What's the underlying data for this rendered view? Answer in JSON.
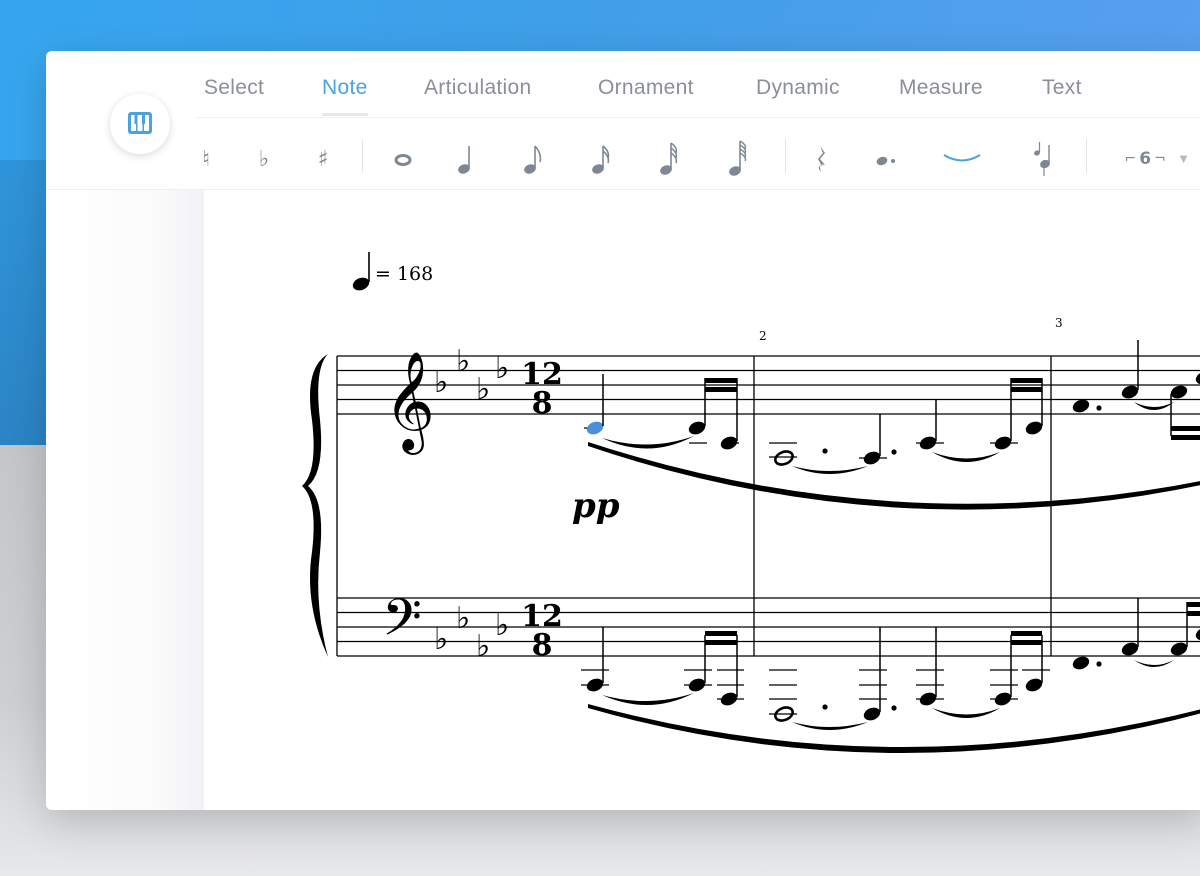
{
  "tabs": [
    {
      "label": "Select",
      "active": false
    },
    {
      "label": "Note",
      "active": true
    },
    {
      "label": "Articulation",
      "active": false
    },
    {
      "label": "Ornament",
      "active": false
    },
    {
      "label": "Dynamic",
      "active": false
    },
    {
      "label": "Measure",
      "active": false
    },
    {
      "label": "Text",
      "active": false
    }
  ],
  "tools": {
    "natural": "♮",
    "flat": "♭",
    "sharp": "♯",
    "tuplet": "6"
  },
  "score": {
    "tempo_value": "= 168",
    "time_signature_top": "12",
    "time_signature_bottom": "8",
    "dynamic": "pp",
    "bar_numbers": [
      "2",
      "3"
    ]
  },
  "colors": {
    "accent": "#4aa3df",
    "icon_gray": "#7f8694",
    "selected_note": "#4a90d9"
  }
}
